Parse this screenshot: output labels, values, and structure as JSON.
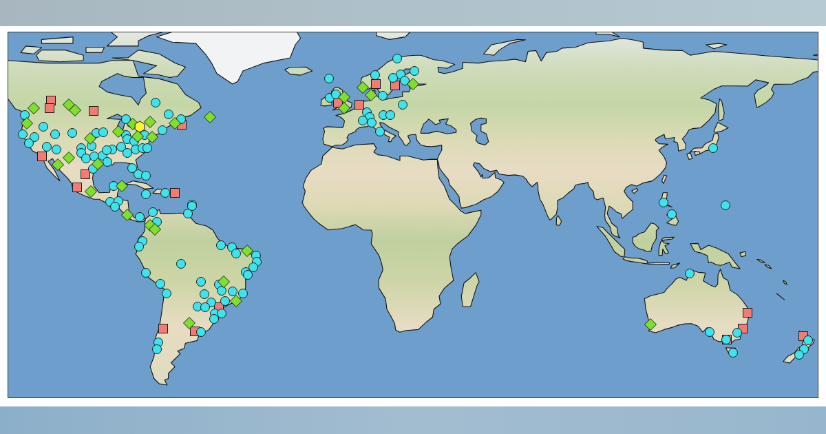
{
  "map": {
    "marker_series": [
      {
        "kind": "square",
        "color": "#f27b74"
      },
      {
        "kind": "circle",
        "color": "#3ee3ec"
      },
      {
        "kind": "diamond",
        "color": "#7ee02c"
      },
      {
        "kind": "hexagon",
        "color": "#f6f733"
      }
    ]
  }
}
